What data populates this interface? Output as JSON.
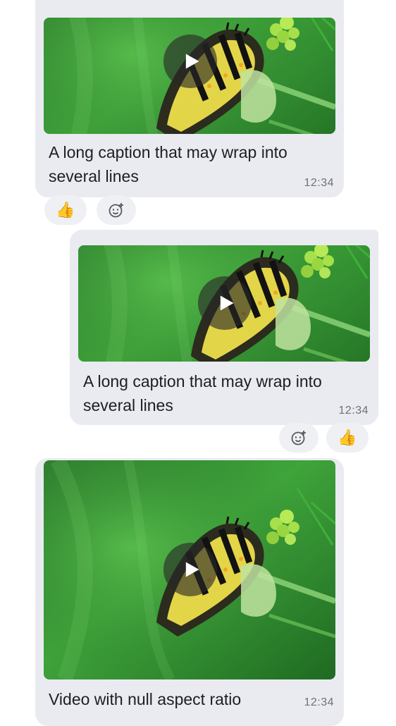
{
  "messages": [
    {
      "caption": "A long caption that may wrap into several lines",
      "time": "12:34",
      "reactions": [
        {
          "emoji": "👍",
          "icon": "thumbs-up-icon"
        },
        {
          "icon": "add-reaction-icon"
        }
      ]
    },
    {
      "caption": "A long caption that may wrap into several lines",
      "time": "12:34",
      "reactions": [
        {
          "icon": "add-reaction-icon"
        },
        {
          "emoji": "👍",
          "icon": "thumbs-up-icon"
        }
      ]
    },
    {
      "caption": "Video with null aspect ratio",
      "time": "12:34"
    }
  ],
  "colors": {
    "bubble": "#e9ebf0",
    "reaction_bg": "#eef0f3",
    "text": "#1e1e22",
    "timestamp": "#6e7278"
  }
}
